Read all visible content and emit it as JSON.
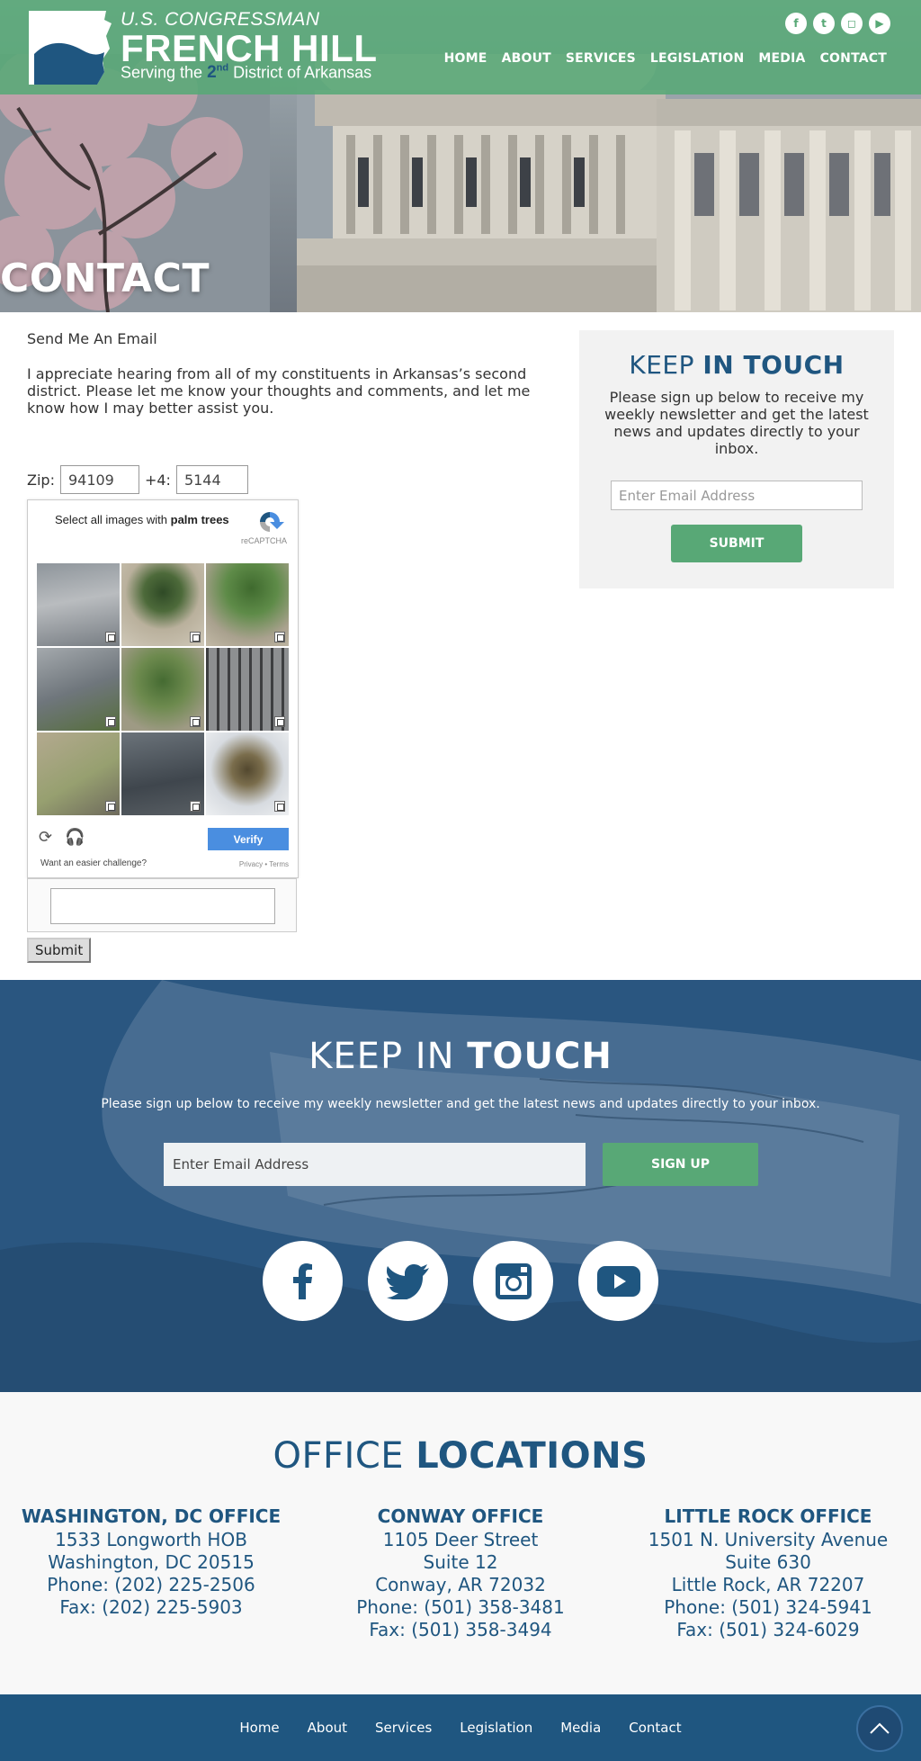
{
  "header": {
    "logo_small": "U.S. CONGRESSMAN",
    "logo_name": "FRENCH HILL",
    "logo_tag_pre": "Serving the ",
    "logo_tag_num": "2",
    "logo_tag_sup": "nd",
    "logo_tag_post": " District of Arkansas",
    "social": [
      {
        "icon": "facebook-icon",
        "glyph": "f"
      },
      {
        "icon": "twitter-icon",
        "glyph": "t"
      },
      {
        "icon": "instagram-icon",
        "glyph": "◻"
      },
      {
        "icon": "youtube-icon",
        "glyph": "▶"
      }
    ],
    "nav": [
      "HOME",
      "ABOUT",
      "SERVICES",
      "LEGISLATION",
      "MEDIA",
      "CONTACT"
    ],
    "hero_title": "CONTACT"
  },
  "form": {
    "heading": "Send Me An Email",
    "intro": "I appreciate hearing from all of my constituents in Arkansas’s second district. Please let me know your thoughts and comments, and let me know how I may better assist you.",
    "zip_label": "Zip:",
    "zip_value": "94109",
    "plus4_label": "+4:",
    "plus4_value": "5144",
    "submit_label": "Submit"
  },
  "captcha": {
    "prompt_pre": "Select all images with ",
    "prompt_target": "palm trees",
    "brand": "reCAPTCHA",
    "verify_label": "Verify",
    "easier": "Want an easier challenge?",
    "privacy": "Privacy • Terms"
  },
  "sidebar": {
    "title_light": "KEEP ",
    "title_bold": "IN TOUCH",
    "text": "Please sign up below to receive my weekly newsletter and get the latest news and updates directly to your inbox.",
    "email_placeholder": "Enter Email Address",
    "submit_label": "SUBMIT"
  },
  "newsletter": {
    "title_light": "KEEP IN ",
    "title_bold": "TOUCH",
    "text": "Please sign up below to receive my weekly newsletter and get the latest news and updates directly to your inbox.",
    "email_placeholder": "Enter Email Address",
    "button_label": "SIGN UP",
    "social": [
      "facebook-icon",
      "twitter-icon",
      "instagram-icon",
      "youtube-icon"
    ]
  },
  "offices": {
    "title_light": "OFFICE ",
    "title_bold": "LOCATIONS",
    "list": [
      {
        "name": "WASHINGTON, DC OFFICE",
        "lines": [
          "1533 Longworth HOB",
          "Washington, DC 20515",
          "Phone: (202) 225-2506",
          "Fax: (202) 225-5903"
        ]
      },
      {
        "name": "CONWAY OFFICE",
        "lines": [
          "1105 Deer Street",
          "Suite 12",
          "Conway, AR 72032",
          "Phone: (501) 358-3481",
          "Fax: (501) 358-3494"
        ]
      },
      {
        "name": "LITTLE ROCK OFFICE",
        "lines": [
          "1501 N. University Avenue",
          "Suite 630",
          "Little Rock, AR 72207",
          "Phone: (501) 324-5941",
          "Fax: (501) 324-6029"
        ]
      }
    ]
  },
  "footer": {
    "nav": [
      "Home",
      "About",
      "Services",
      "Legislation",
      "Media",
      "Contact"
    ]
  },
  "colors": {
    "brand_green": "#58a876",
    "brand_blue": "#1f5680"
  }
}
